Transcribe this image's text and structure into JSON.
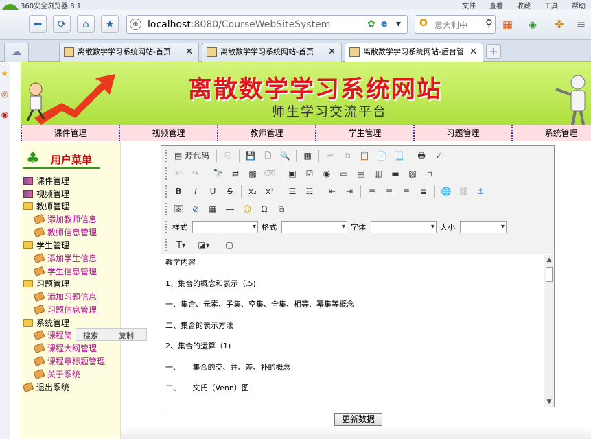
{
  "browser": {
    "window_title": "360安全浏览器 8.1",
    "menu": [
      "文件",
      "查看",
      "收藏",
      "工具",
      "帮助"
    ],
    "address": {
      "host": "localhost",
      "rest": ":8080/CourseWebSiteSystem"
    },
    "search_placeholder": "意大利中",
    "tabs": [
      {
        "label": "离散数学学习系统网站-首页",
        "active": false
      },
      {
        "label": "离散数学学习系统网站-首页",
        "active": false
      },
      {
        "label": "离散数学学习系统网站-后台管",
        "active": true
      }
    ]
  },
  "banner": {
    "title": "离散数学学习系统网站",
    "subtitle": "师生学习交流平台"
  },
  "nav": [
    "课件管理",
    "视频管理",
    "教师管理",
    "学生管理",
    "习题管理",
    "系统管理"
  ],
  "sidebar": {
    "heading": "用户菜单",
    "items": [
      {
        "label": "课件管理",
        "type": "book",
        "sub": false
      },
      {
        "label": "视频管理",
        "type": "book",
        "sub": false
      },
      {
        "label": "教师管理",
        "type": "folder",
        "sub": false
      },
      {
        "label": "添加教师信息",
        "type": "leaf",
        "sub": true
      },
      {
        "label": "教师信息管理",
        "type": "leaf",
        "sub": true
      },
      {
        "label": "学生管理",
        "type": "folder",
        "sub": false
      },
      {
        "label": "添加学生信息",
        "type": "leaf",
        "sub": true
      },
      {
        "label": "学生信息管理",
        "type": "leaf",
        "sub": true
      },
      {
        "label": "习题管理",
        "type": "folder",
        "sub": false
      },
      {
        "label": "添加习题信息",
        "type": "leaf",
        "sub": true
      },
      {
        "label": "习题信息管理",
        "type": "leaf",
        "sub": true
      },
      {
        "label": "系统管理",
        "type": "folder",
        "sub": false
      },
      {
        "label": "课程简",
        "type": "leaf",
        "sub": true
      },
      {
        "label": "课程大纲管理",
        "type": "leaf",
        "sub": true
      },
      {
        "label": "课程章标题管理",
        "type": "leaf",
        "sub": true
      },
      {
        "label": "关于系统",
        "type": "leaf",
        "sub": true
      },
      {
        "label": "退出系统",
        "type": "leaf",
        "sub": false
      }
    ]
  },
  "context_menu": {
    "search": "搜索",
    "copy": "复制"
  },
  "editor": {
    "source_label": "源代码",
    "format_labels": {
      "style": "样式",
      "format": "格式",
      "font": "字体",
      "size": "大小"
    },
    "content": [
      "教学内容",
      "1、集合的概念和表示（.5)",
      "一、集合、元素、子集、空集、全集、相等、幂集等概念",
      "二、集合的表示方法",
      "2、集合的运算（1)",
      "一、     集合的交、并、差、补的概念",
      "二、     文氏（Venn）图"
    ]
  },
  "submit_label": "更新数据"
}
